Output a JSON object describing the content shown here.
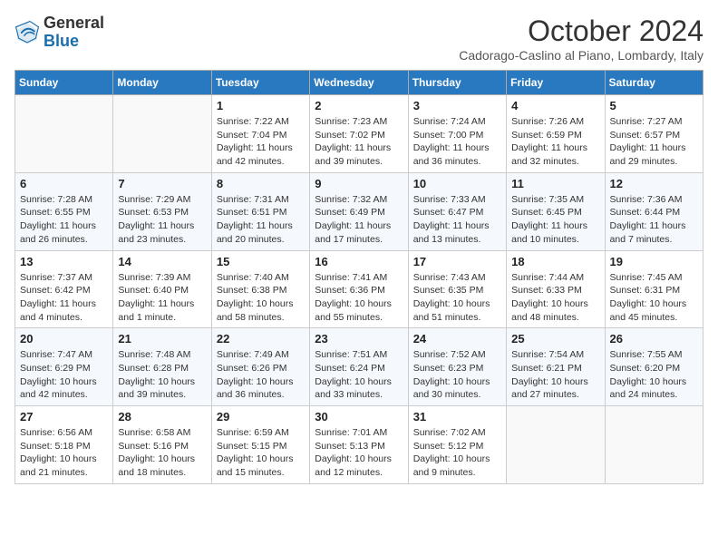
{
  "header": {
    "logo": {
      "general": "General",
      "blue": "Blue"
    },
    "title": "October 2024",
    "subtitle": "Cadorago-Caslino al Piano, Lombardy, Italy"
  },
  "days_of_week": [
    "Sunday",
    "Monday",
    "Tuesday",
    "Wednesday",
    "Thursday",
    "Friday",
    "Saturday"
  ],
  "weeks": [
    [
      {
        "num": "",
        "sunrise": "",
        "sunset": "",
        "daylight": ""
      },
      {
        "num": "",
        "sunrise": "",
        "sunset": "",
        "daylight": ""
      },
      {
        "num": "1",
        "sunrise": "Sunrise: 7:22 AM",
        "sunset": "Sunset: 7:04 PM",
        "daylight": "Daylight: 11 hours and 42 minutes."
      },
      {
        "num": "2",
        "sunrise": "Sunrise: 7:23 AM",
        "sunset": "Sunset: 7:02 PM",
        "daylight": "Daylight: 11 hours and 39 minutes."
      },
      {
        "num": "3",
        "sunrise": "Sunrise: 7:24 AM",
        "sunset": "Sunset: 7:00 PM",
        "daylight": "Daylight: 11 hours and 36 minutes."
      },
      {
        "num": "4",
        "sunrise": "Sunrise: 7:26 AM",
        "sunset": "Sunset: 6:59 PM",
        "daylight": "Daylight: 11 hours and 32 minutes."
      },
      {
        "num": "5",
        "sunrise": "Sunrise: 7:27 AM",
        "sunset": "Sunset: 6:57 PM",
        "daylight": "Daylight: 11 hours and 29 minutes."
      }
    ],
    [
      {
        "num": "6",
        "sunrise": "Sunrise: 7:28 AM",
        "sunset": "Sunset: 6:55 PM",
        "daylight": "Daylight: 11 hours and 26 minutes."
      },
      {
        "num": "7",
        "sunrise": "Sunrise: 7:29 AM",
        "sunset": "Sunset: 6:53 PM",
        "daylight": "Daylight: 11 hours and 23 minutes."
      },
      {
        "num": "8",
        "sunrise": "Sunrise: 7:31 AM",
        "sunset": "Sunset: 6:51 PM",
        "daylight": "Daylight: 11 hours and 20 minutes."
      },
      {
        "num": "9",
        "sunrise": "Sunrise: 7:32 AM",
        "sunset": "Sunset: 6:49 PM",
        "daylight": "Daylight: 11 hours and 17 minutes."
      },
      {
        "num": "10",
        "sunrise": "Sunrise: 7:33 AM",
        "sunset": "Sunset: 6:47 PM",
        "daylight": "Daylight: 11 hours and 13 minutes."
      },
      {
        "num": "11",
        "sunrise": "Sunrise: 7:35 AM",
        "sunset": "Sunset: 6:45 PM",
        "daylight": "Daylight: 11 hours and 10 minutes."
      },
      {
        "num": "12",
        "sunrise": "Sunrise: 7:36 AM",
        "sunset": "Sunset: 6:44 PM",
        "daylight": "Daylight: 11 hours and 7 minutes."
      }
    ],
    [
      {
        "num": "13",
        "sunrise": "Sunrise: 7:37 AM",
        "sunset": "Sunset: 6:42 PM",
        "daylight": "Daylight: 11 hours and 4 minutes."
      },
      {
        "num": "14",
        "sunrise": "Sunrise: 7:39 AM",
        "sunset": "Sunset: 6:40 PM",
        "daylight": "Daylight: 11 hours and 1 minute."
      },
      {
        "num": "15",
        "sunrise": "Sunrise: 7:40 AM",
        "sunset": "Sunset: 6:38 PM",
        "daylight": "Daylight: 10 hours and 58 minutes."
      },
      {
        "num": "16",
        "sunrise": "Sunrise: 7:41 AM",
        "sunset": "Sunset: 6:36 PM",
        "daylight": "Daylight: 10 hours and 55 minutes."
      },
      {
        "num": "17",
        "sunrise": "Sunrise: 7:43 AM",
        "sunset": "Sunset: 6:35 PM",
        "daylight": "Daylight: 10 hours and 51 minutes."
      },
      {
        "num": "18",
        "sunrise": "Sunrise: 7:44 AM",
        "sunset": "Sunset: 6:33 PM",
        "daylight": "Daylight: 10 hours and 48 minutes."
      },
      {
        "num": "19",
        "sunrise": "Sunrise: 7:45 AM",
        "sunset": "Sunset: 6:31 PM",
        "daylight": "Daylight: 10 hours and 45 minutes."
      }
    ],
    [
      {
        "num": "20",
        "sunrise": "Sunrise: 7:47 AM",
        "sunset": "Sunset: 6:29 PM",
        "daylight": "Daylight: 10 hours and 42 minutes."
      },
      {
        "num": "21",
        "sunrise": "Sunrise: 7:48 AM",
        "sunset": "Sunset: 6:28 PM",
        "daylight": "Daylight: 10 hours and 39 minutes."
      },
      {
        "num": "22",
        "sunrise": "Sunrise: 7:49 AM",
        "sunset": "Sunset: 6:26 PM",
        "daylight": "Daylight: 10 hours and 36 minutes."
      },
      {
        "num": "23",
        "sunrise": "Sunrise: 7:51 AM",
        "sunset": "Sunset: 6:24 PM",
        "daylight": "Daylight: 10 hours and 33 minutes."
      },
      {
        "num": "24",
        "sunrise": "Sunrise: 7:52 AM",
        "sunset": "Sunset: 6:23 PM",
        "daylight": "Daylight: 10 hours and 30 minutes."
      },
      {
        "num": "25",
        "sunrise": "Sunrise: 7:54 AM",
        "sunset": "Sunset: 6:21 PM",
        "daylight": "Daylight: 10 hours and 27 minutes."
      },
      {
        "num": "26",
        "sunrise": "Sunrise: 7:55 AM",
        "sunset": "Sunset: 6:20 PM",
        "daylight": "Daylight: 10 hours and 24 minutes."
      }
    ],
    [
      {
        "num": "27",
        "sunrise": "Sunrise: 6:56 AM",
        "sunset": "Sunset: 5:18 PM",
        "daylight": "Daylight: 10 hours and 21 minutes."
      },
      {
        "num": "28",
        "sunrise": "Sunrise: 6:58 AM",
        "sunset": "Sunset: 5:16 PM",
        "daylight": "Daylight: 10 hours and 18 minutes."
      },
      {
        "num": "29",
        "sunrise": "Sunrise: 6:59 AM",
        "sunset": "Sunset: 5:15 PM",
        "daylight": "Daylight: 10 hours and 15 minutes."
      },
      {
        "num": "30",
        "sunrise": "Sunrise: 7:01 AM",
        "sunset": "Sunset: 5:13 PM",
        "daylight": "Daylight: 10 hours and 12 minutes."
      },
      {
        "num": "31",
        "sunrise": "Sunrise: 7:02 AM",
        "sunset": "Sunset: 5:12 PM",
        "daylight": "Daylight: 10 hours and 9 minutes."
      },
      {
        "num": "",
        "sunrise": "",
        "sunset": "",
        "daylight": ""
      },
      {
        "num": "",
        "sunrise": "",
        "sunset": "",
        "daylight": ""
      }
    ]
  ]
}
